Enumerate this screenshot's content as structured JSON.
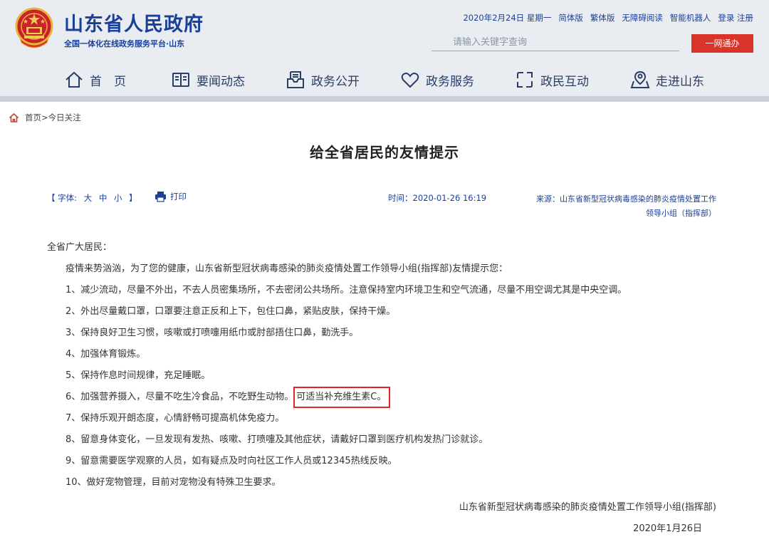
{
  "header": {
    "site_title": "山东省人民政府",
    "site_subtitle": "全国一体化在线政务服务平台·山东",
    "top_links": [
      "2020年2月24日 星期一",
      "简体版",
      "繁体版",
      "无障碍阅读",
      "智能机器人",
      "登录 注册"
    ],
    "search_placeholder": "请输入关键字查询",
    "one_net_button": "一网通办",
    "colors": {
      "brand_blue": "#1a3f99",
      "header_bg": "#e9edf1",
      "accent_red": "#d8342a"
    }
  },
  "nav": {
    "items": [
      {
        "label": "首　页",
        "icon": "house-icon"
      },
      {
        "label": "要闻动态",
        "icon": "book-icon"
      },
      {
        "label": "政务公开",
        "icon": "inbox-icon"
      },
      {
        "label": "政务服务",
        "icon": "heart-icon"
      },
      {
        "label": "政民互动",
        "icon": "exchange-icon"
      },
      {
        "label": "走进山东",
        "icon": "map-pin-icon"
      }
    ]
  },
  "breadcrumb": {
    "text": "首页>今日关注"
  },
  "article": {
    "title": "给全省居民的友情提示",
    "font_label": "【 字体:",
    "font_sizes": [
      "大",
      "中",
      "小"
    ],
    "font_close": "】",
    "print_label": "打印",
    "time": "时间：2020-01-26 16:19",
    "source_line1": "来源：山东省新型冠状病毒感染的肺炎疫情处置工作",
    "source_line2": "领导小组（指挥部）",
    "salutation": "全省广大居民：",
    "intro": "疫情来势汹汹，为了您的健康，山东省新型冠状病毒感染的肺炎疫情处置工作领导小组(指挥部)友情提示您：",
    "items": [
      "1、减少流动，尽量不外出，不去人员密集场所，不去密闭公共场所。注意保持室内环境卫生和空气流通，尽量不用空调尤其是中央空调。",
      "2、外出尽量戴口罩，口罩要注意正反和上下，包住口鼻，紧贴皮肤，保持干燥。",
      "3、保持良好卫生习惯，咳嗽或打喷嚏用纸巾或肘部捂住口鼻，勤洗手。",
      "4、加强体育锻炼。",
      "5、保持作息时间规律，充足睡眠。",
      "6、加强营养摄入，尽量不吃生冷食品，不吃野生动物。",
      "7、保持乐观开朗态度，心情舒畅可提高机体免疫力。",
      "8、留意身体变化，一旦发现有发热、咳嗽、打喷嚏及其他症状，请戴好口罩到医疗机构发热门诊就诊。",
      "9、留意需要医学观察的人员，如有疑点及时向社区工作人员或12345热线反映。",
      "10、做好宠物管理，目前对宠物没有特殊卫生要求。"
    ],
    "highlighted_text": "可适当补充维生素C。",
    "highlight_color": "#e0242a",
    "sign_org": "山东省新型冠状病毒感染的肺炎疫情处置工作领导小组(指挥部)",
    "sign_date": "2020年1月26日"
  }
}
